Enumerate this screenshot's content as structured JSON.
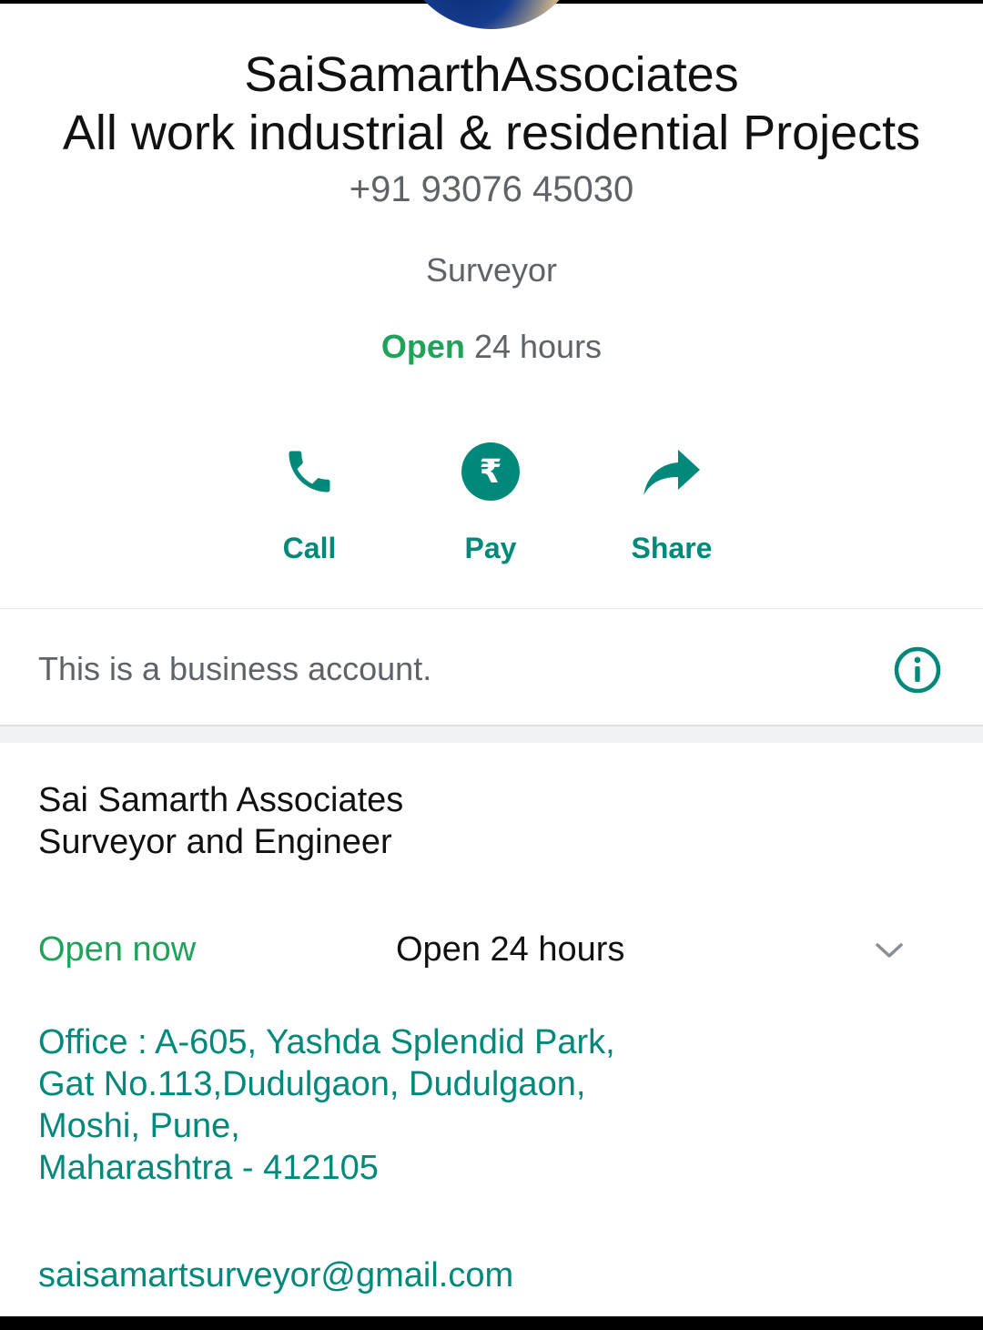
{
  "profile": {
    "name": "SaiSamarthAssociates",
    "tagline": "All work industrial & residential Projects",
    "phone": "+91 93076 45030",
    "category": "Surveyor",
    "status_open": "Open",
    "status_hours": "24 hours"
  },
  "actions": {
    "call": "Call",
    "pay": "Pay",
    "share": "Share",
    "pay_icon_glyph": "₹"
  },
  "business_notice": "This is a business account.",
  "details": {
    "description_line1": "Sai Samarth Associates",
    "description_line2": "Surveyor and Engineer",
    "open_now": "Open now",
    "hours": "Open 24 hours",
    "address": [
      "Office : A-605, Yashda Splendid Park,",
      "Gat No.113,Dudulgaon, Dudulgaon,",
      "Moshi, Pune,",
      "Maharashtra - 412105"
    ],
    "email": "saisamartsurveyor@gmail.com"
  },
  "colors": {
    "accent": "#00897b",
    "open_green": "#1fa35a",
    "muted": "#5f6368"
  },
  "icons": [
    "phone-icon",
    "rupee-icon",
    "share-icon",
    "info-icon",
    "chevron-down-icon"
  ]
}
